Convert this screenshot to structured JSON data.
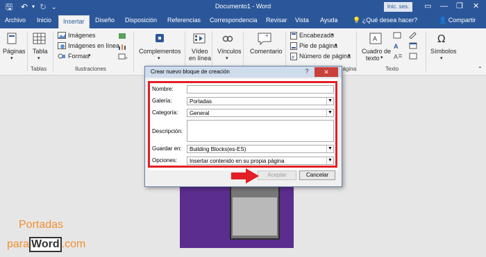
{
  "window": {
    "title": "Documento1 - Word",
    "signin_label": "Inic. ses.",
    "tell_me": "¿Qué desea hacer?",
    "share": "Compartir"
  },
  "tabs": [
    "Archivo",
    "Inicio",
    "Insertar",
    "Diseño",
    "Disposición",
    "Referencias",
    "Correspondencia",
    "Revisar",
    "Vista",
    "Ayuda"
  ],
  "ribbon": {
    "paginas": "Páginas",
    "tabla": "Tabla",
    "tablas_group": "Tablas",
    "imagenes": "Imágenes",
    "imagenes_linea": "Imágenes en línea",
    "formas": "Formas",
    "ilustraciones_group": "Ilustraciones",
    "complementos": "Complementos",
    "video_1": "Vídeo",
    "video_2": "en línea",
    "vinculos": "Vínculos",
    "comentario": "Comentario",
    "encabezado": "Encabezado",
    "pie_pagina": "Pie de página",
    "numero_pagina": "Número de página",
    "pagina_group": "página",
    "cuadro_1": "Cuadro de",
    "cuadro_2": "texto",
    "texto_group": "Texto",
    "simbolos": "Símbolos"
  },
  "dialog": {
    "title": "Crear nuevo bloque de creación",
    "help": "?",
    "close": "✕",
    "fields": {
      "nombre_label": "Nombre:",
      "nombre_value": "",
      "galeria_label": "Galería:",
      "galeria_value": "Portadas",
      "categoria_label": "Categoría:",
      "categoria_value": "General",
      "descripcion_label": "Descripción:",
      "descripcion_value": "",
      "guardar_label": "Guardar en:",
      "guardar_value": "Building Blocks(es-ES)",
      "opciones_label": "Opciones:",
      "opciones_value": "Insertar contenido en su propia página"
    },
    "accept": "Aceptar",
    "cancel": "Cancelar"
  },
  "watermark": {
    "line1": "Portadas",
    "para": "para",
    "word": "Word",
    "com": ".com"
  },
  "colors": {
    "brand_blue": "#2b579a",
    "highlight_red": "#e31e24",
    "cover_purple": "#5b2d8e",
    "watermark_orange": "#f0902f"
  }
}
